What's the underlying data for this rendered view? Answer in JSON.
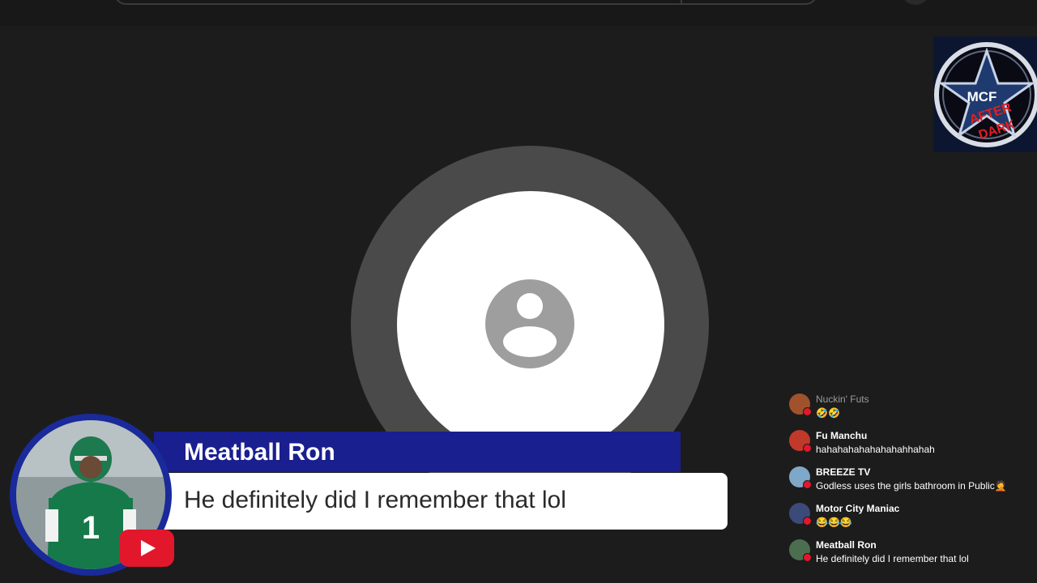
{
  "banner": {
    "name": "Meatball Ron",
    "message": "He definitely did I remember that lol",
    "jersey_number": "1"
  },
  "logo": {
    "line1": "MCF",
    "line2": "AFTER",
    "line3": "DARK"
  },
  "chat": [
    {
      "name": "Nuckin' Futs",
      "message": "🤣🤣",
      "avatar_color": "#a0522d"
    },
    {
      "name": "Fu Manchu",
      "message": "hahahahahahahahahhahah",
      "avatar_color": "#c0392b"
    },
    {
      "name": "BREEZE TV",
      "message": "Godless uses the girls bathroom in Public🤦",
      "avatar_color": "#7fa7c7"
    },
    {
      "name": "Motor City Maniac",
      "message": "😂😂😂",
      "avatar_color": "#3b4a78"
    },
    {
      "name": "Meatball Ron",
      "message": "He definitely did I remember that lol",
      "avatar_color": "#4b6e4f"
    }
  ],
  "colors": {
    "background": "#1c1c1c",
    "banner_blue": "#1a1f8f",
    "youtube_red": "#e3172b"
  }
}
